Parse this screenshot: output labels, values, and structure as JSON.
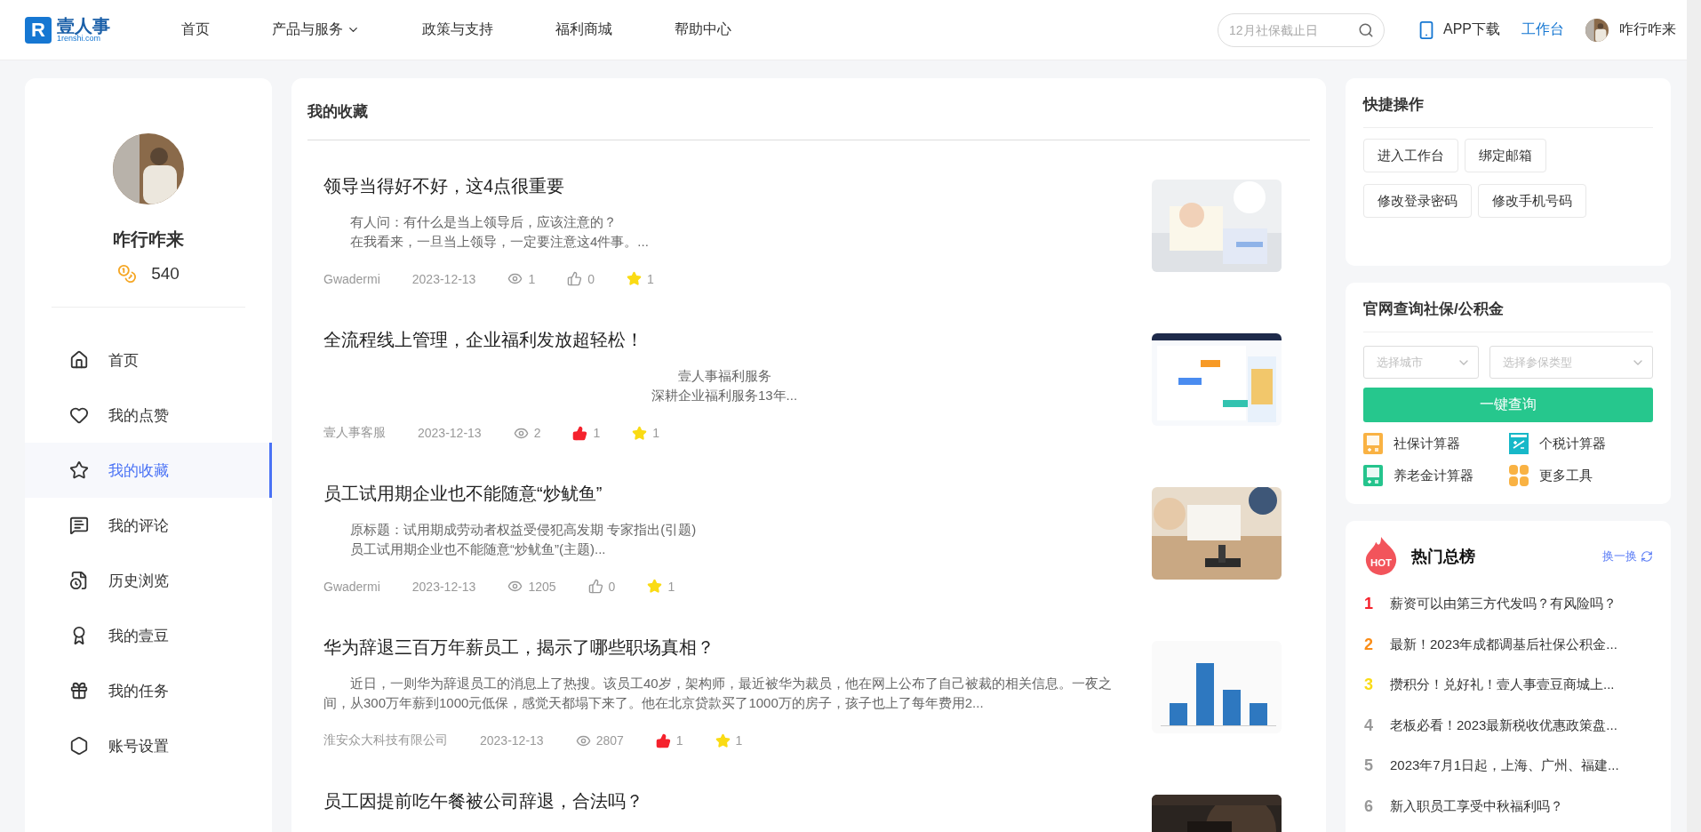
{
  "header": {
    "logo": {
      "mark": "R",
      "name": "壹人事",
      "domain": "1renshi.com"
    },
    "nav": [
      {
        "label": "首页",
        "dropdown": false
      },
      {
        "label": "产品与服务",
        "dropdown": true
      },
      {
        "label": "政策与支持",
        "dropdown": false
      },
      {
        "label": "福利商城",
        "dropdown": false
      },
      {
        "label": "帮助中心",
        "dropdown": false
      }
    ],
    "search": {
      "placeholder": "12月社保截止日"
    },
    "app_download": "APP下载",
    "workbench": "工作台",
    "user_name": "咋行咋来"
  },
  "profile": {
    "name": "咋行咋来",
    "coins": "540"
  },
  "sidebar": {
    "items": [
      {
        "label": "首页",
        "selected": false
      },
      {
        "label": "我的点赞",
        "selected": false
      },
      {
        "label": "我的收藏",
        "selected": true
      },
      {
        "label": "我的评论",
        "selected": false
      },
      {
        "label": "历史浏览",
        "selected": false
      },
      {
        "label": "我的壹豆",
        "selected": false
      },
      {
        "label": "我的任务",
        "selected": false
      },
      {
        "label": "账号设置",
        "selected": false
      }
    ]
  },
  "favorites": {
    "title": "我的收藏",
    "articles": [
      {
        "title": "领导当得好不好，这4点很重要",
        "summary": [
          "有人问：有什么是当上领导后，应该注意的？",
          "在我看来，一旦当上领导，一定要注意这4件事。..."
        ],
        "centered": false,
        "author": "Gwadermi",
        "date": "2023-12-13",
        "views": "1",
        "likes": "0",
        "liked": false,
        "stars": "1",
        "favorited": true
      },
      {
        "title": "全流程线上管理，企业福利发放超轻松！",
        "summary": [
          "壹人事福利服务",
          "深耕企业福利服务13年..."
        ],
        "centered": true,
        "author": "壹人事客服",
        "date": "2023-12-13",
        "views": "2",
        "likes": "1",
        "liked": true,
        "stars": "1",
        "favorited": true
      },
      {
        "title": "员工试用期企业也不能随意“炒鱿鱼”",
        "summary": [
          "原标题：试用期成劳动者权益受侵犯高发期 专家指出(引题)",
          "员工试用期企业也不能随意“炒鱿鱼”(主题)..."
        ],
        "centered": false,
        "author": "Gwadermi",
        "date": "2023-12-13",
        "views": "1205",
        "likes": "0",
        "liked": false,
        "stars": "1",
        "favorited": true
      },
      {
        "title": "华为辞退三百万年薪员工，揭示了哪些职场真相？",
        "summary": [
          "近日，一则华为辞退员工的消息上了热搜。该员工40岁，架构师，最近被华为裁员，他在网上公布了自己被裁的相关信息。一夜之间，从300万年薪到1000元低保，感觉天都塌下来了。他在北京贷款买了1000万的房子，孩子也上了每年费用2..."
        ],
        "centered": false,
        "author": "淮安众大科技有限公司",
        "date": "2023-12-13",
        "views": "2807",
        "likes": "1",
        "liked": true,
        "stars": "1",
        "favorited": true
      },
      {
        "title": "员工因提前吃午餐被公司辞退，合法吗？"
      }
    ]
  },
  "quick_actions": {
    "title": "快捷操作",
    "buttons": [
      "进入工作台",
      "绑定邮箱",
      "修改登录密码",
      "修改手机号码"
    ]
  },
  "social_query": {
    "title": "官网查询社保/公积金",
    "city": {
      "placeholder": "选择城市"
    },
    "type": {
      "placeholder": "选择参保类型"
    },
    "submit": "一键查询",
    "tools": [
      {
        "label": "社保计算器",
        "color": "#f9b243"
      },
      {
        "label": "个税计算器",
        "color": "#17b8c8"
      },
      {
        "label": "养老金计算器",
        "color": "#25c48d"
      },
      {
        "label": "更多工具",
        "color": "#f9b243"
      }
    ]
  },
  "hot": {
    "title": "热门总榜",
    "badge": "HOT",
    "refresh": "换一换",
    "items": [
      {
        "rank": "1",
        "text": "薪资可以由第三方代发吗？有风险吗？",
        "color": "#f5222d"
      },
      {
        "rank": "2",
        "text": "最新！2023年成都调基后社保公积金...",
        "color": "#fa8c16"
      },
      {
        "rank": "3",
        "text": "攒积分！兑好礼！壹人事壹豆商城上...",
        "color": "#fadb14"
      },
      {
        "rank": "4",
        "text": "老板必看！2023最新税收优惠政策盘...",
        "color": "#999999"
      },
      {
        "rank": "5",
        "text": "2023年7月1日起，上海、广州、福建...",
        "color": "#999999"
      },
      {
        "rank": "6",
        "text": "新入职员工享受中秋福利吗？",
        "color": "#999999"
      }
    ]
  }
}
